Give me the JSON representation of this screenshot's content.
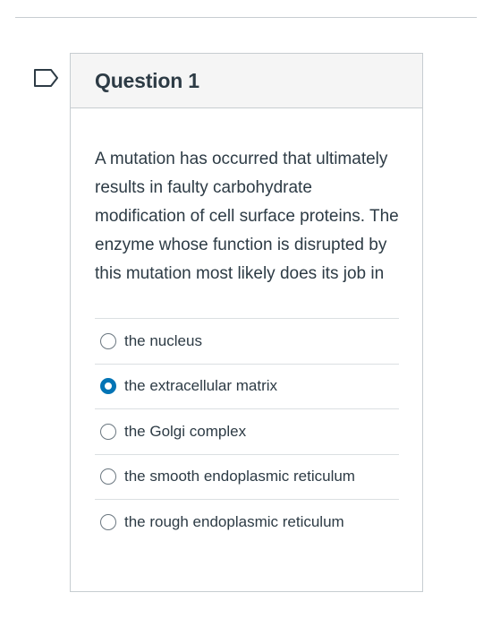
{
  "question": {
    "title": "Question 1",
    "text": "A mutation has occurred that ultimately results in faulty carbohydrate modification of cell surface proteins.  The enzyme whose function is disrupted by this mutation most likely does its job in",
    "answers": [
      {
        "label": "the nucleus",
        "selected": false
      },
      {
        "label": "the extracellular matrix",
        "selected": true
      },
      {
        "label": "the Golgi complex",
        "selected": false
      },
      {
        "label": "the smooth endoplasmic reticulum",
        "selected": false
      },
      {
        "label": "the rough endoplasmic reticulum",
        "selected": false
      }
    ]
  },
  "icons": {
    "flag": "flag-outline-icon",
    "radio": "radio-icon"
  },
  "colors": {
    "text": "#2d3b45",
    "border": "#c7cdd1",
    "header_bg": "#f5f5f5",
    "selected_radio": "#0374b5"
  }
}
